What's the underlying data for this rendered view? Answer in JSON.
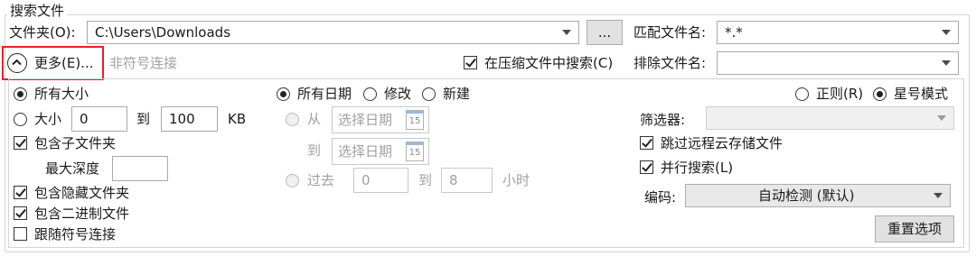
{
  "group": {
    "title": "搜索文件"
  },
  "folder": {
    "label": "文件夹(O):",
    "value": "C:\\Users\\Downloads",
    "browse_label": "..."
  },
  "match_name": {
    "label": "匹配文件名:",
    "value": "*.*"
  },
  "more": {
    "label": "更多(E)...",
    "symlink_hint": "非符号连接"
  },
  "search_compressed": {
    "label": "在压缩文件中搜索(C)",
    "checked": true
  },
  "exclude_name": {
    "label": "排除文件名:",
    "value": ""
  },
  "size": {
    "all_label": "所有大小",
    "range_label": "大小",
    "min": "0",
    "to_label": "到",
    "max": "100",
    "unit": "KB"
  },
  "options_left": {
    "include_subfolders": "包含子文件夹",
    "max_depth": "最大深度",
    "max_depth_value": "",
    "include_hidden": "包含隐藏文件夹",
    "include_binary": "包含二进制文件",
    "follow_symlinks": "跟随符号连接"
  },
  "date": {
    "all_label": "所有日期",
    "modified_label": "修改",
    "created_label": "新建",
    "from_label": "从",
    "to_label": "到",
    "date_placeholder": "选择日期",
    "calendar_day": "15",
    "past_label": "过去",
    "past_min": "0",
    "past_to": "到",
    "past_max": "8",
    "past_unit": "小时"
  },
  "mode": {
    "regex_label": "正则(R)",
    "wildcard_label": "星号模式"
  },
  "filter": {
    "label": "筛选器:",
    "value": ""
  },
  "skip_cloud": {
    "label": "跳过远程云存储文件",
    "checked": true
  },
  "parallel": {
    "label": "并行搜索(L)",
    "checked": true
  },
  "encoding": {
    "label": "编码:",
    "value": "自动检测 (默认)"
  },
  "reset": {
    "label": "重置选项"
  }
}
